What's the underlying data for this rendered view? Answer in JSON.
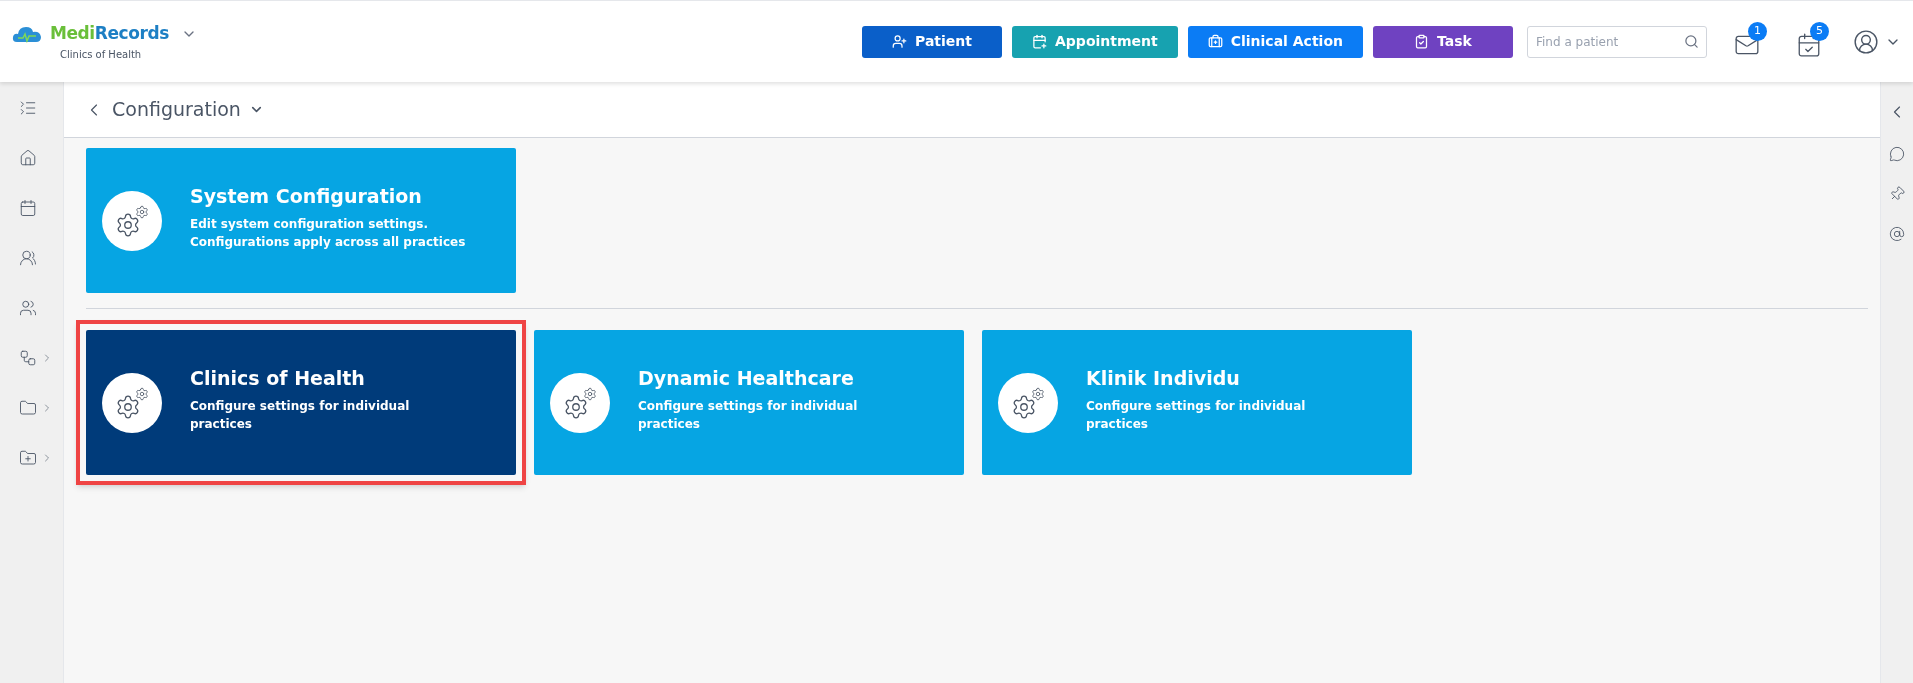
{
  "header": {
    "brand_part_1": "Medi",
    "brand_part_2": "Records",
    "practice": "Clinics of Health",
    "actions": [
      {
        "label": "Patient",
        "color": "#0a5fc9"
      },
      {
        "label": "Appointment",
        "color": "#17a2b0"
      },
      {
        "label": "Clinical Action",
        "color": "#0b7cf5"
      },
      {
        "label": "Task",
        "color": "#6f42c1"
      }
    ],
    "search": {
      "placeholder": "Find a patient"
    },
    "notifications": [
      {
        "badge": "1"
      },
      {
        "badge": "5"
      }
    ]
  },
  "sidebar": {
    "items": [
      {
        "has_submenu": false
      },
      {
        "has_submenu": false
      },
      {
        "has_submenu": false
      },
      {
        "has_submenu": false
      },
      {
        "has_submenu": false
      },
      {
        "has_submenu": true
      },
      {
        "has_submenu": true
      },
      {
        "has_submenu": true
      }
    ]
  },
  "page": {
    "title": "Configuration",
    "system_card": {
      "title": "System Configuration",
      "description": "Edit system configuration settings. Configurations apply across all practices"
    },
    "practices": [
      {
        "title": "Clinics of Health",
        "description": "Configure settings for individual practices",
        "selected": true
      },
      {
        "title": "Dynamic Healthcare",
        "description": "Configure settings for individual practices",
        "selected": false
      },
      {
        "title": "Klinik Individu",
        "description": "Configure settings for individual practices",
        "selected": false
      }
    ]
  }
}
